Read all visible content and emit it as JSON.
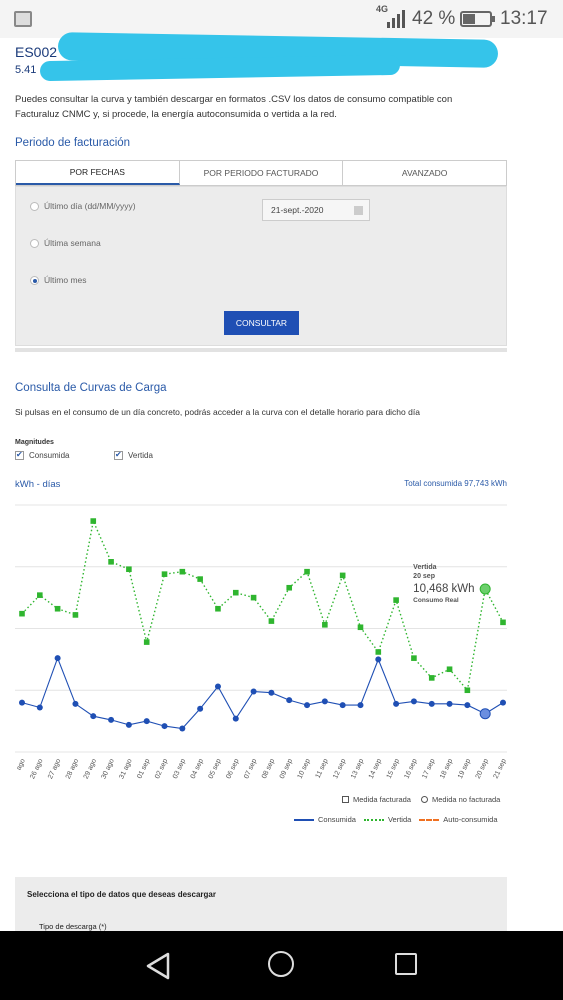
{
  "status_bar": {
    "network": "4G",
    "battery_pct": "42 %",
    "battery_level": 0.42,
    "time": "13:17"
  },
  "cups": {
    "line1": "ES002",
    "line2": "5.41"
  },
  "intro_text": "Puedes consultar la curva y también descargar en formatos .CSV los datos de consumo compatible con Facturaluz CNMC y, si procede, la energía autoconsumida o vertida a la red.",
  "billing": {
    "title": "Periodo de facturación",
    "tabs": [
      "POR FECHAS",
      "POR PERIODO FACTURADO",
      "AVANZADO"
    ],
    "options": [
      "Último día (dd/MM/yyyy)",
      "Última semana",
      "Último mes"
    ],
    "selected_option": 2,
    "date_value": "21-sept.-2020",
    "button": "CONSULTAR"
  },
  "curves": {
    "title": "Consulta de Curvas de Carga",
    "description": "Si pulsas en el consumo de un día concreto, podrás acceder a la curva con el detalle horario para dicho día",
    "magnitudes_label": "Magnitudes",
    "checks": [
      "Consumida",
      "Vertida"
    ],
    "units_label": "kWh - días",
    "total_label": "Total consumida",
    "total_value": "97,743 kWh"
  },
  "tooltip": {
    "series": "Vertida",
    "date": "20 sep",
    "value": "10,468 kWh",
    "note": "Consumo Real"
  },
  "legend": {
    "markers": [
      "Medida facturada",
      "Medida no facturada"
    ],
    "lines": [
      "Consumida",
      "Vertida",
      "Auto-consumida"
    ]
  },
  "download": {
    "title": "Selecciona el tipo de datos que deseas descargar",
    "field": "Tipo de descarga (*)"
  },
  "chart_data": {
    "type": "line",
    "x": [
      "ago",
      "26 ago",
      "27 ago",
      "28 ago",
      "29 ago",
      "30 ago",
      "31 ago",
      "01 sep",
      "02 sep",
      "03 sep",
      "04 sep",
      "05 sep",
      "06 sep",
      "07 sep",
      "08 sep",
      "09 sep",
      "10 sep",
      "11 sep",
      "12 sep",
      "13 sep",
      "14 sep",
      "15 sep",
      "16 sep",
      "17 sep",
      "18 sep",
      "19 sep",
      "20 sep",
      "21 sep"
    ],
    "series": [
      {
        "name": "Consumida",
        "color": "#1f4fb4",
        "style": "solid",
        "values": [
          4.0,
          3.6,
          7.6,
          3.9,
          2.9,
          2.6,
          2.2,
          2.5,
          2.1,
          1.9,
          3.5,
          5.3,
          2.7,
          4.9,
          4.8,
          4.2,
          3.8,
          4.1,
          3.8,
          3.8,
          7.5,
          3.9,
          4.1,
          3.9,
          3.9,
          3.8,
          3.1,
          4.0
        ]
      },
      {
        "name": "Vertida",
        "color": "#2fb52f",
        "style": "dotted",
        "values": [
          11.2,
          12.7,
          11.6,
          11.1,
          18.7,
          15.4,
          14.8,
          8.9,
          14.4,
          14.6,
          14.0,
          11.6,
          12.9,
          12.5,
          10.6,
          13.3,
          14.6,
          10.3,
          14.3,
          10.1,
          8.1,
          12.3,
          7.6,
          6.0,
          6.7,
          5.0,
          13.2,
          10.5
        ]
      }
    ],
    "ylim": [
      0,
      20
    ],
    "grid": true
  }
}
